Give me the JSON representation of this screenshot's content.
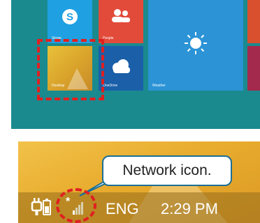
{
  "start_screen": {
    "tiles": {
      "skype": {
        "label": "Skype",
        "icon": "skype-icon",
        "color": "#1fa0e2"
      },
      "people": {
        "label": "People",
        "icon": "people-icon",
        "color": "#e24b3a"
      },
      "desktop": {
        "label": "Desktop",
        "color": "#d9a32b"
      },
      "onedrive": {
        "label": "OneDrive",
        "icon": "cloud-icon",
        "color": "#1a5fa8"
      },
      "weather": {
        "label": "Weather",
        "icon": "sun-icon",
        "color": "#2b93d6"
      }
    },
    "background_color": "#1a8a8f",
    "highlight_color": "#e02020"
  },
  "taskbar": {
    "language": "ENG",
    "time": "2:29 PM",
    "icons": [
      "power-plug-icon",
      "network-icon"
    ]
  },
  "callout": {
    "text": "Network icon.",
    "border_color": "#1a6f95"
  }
}
